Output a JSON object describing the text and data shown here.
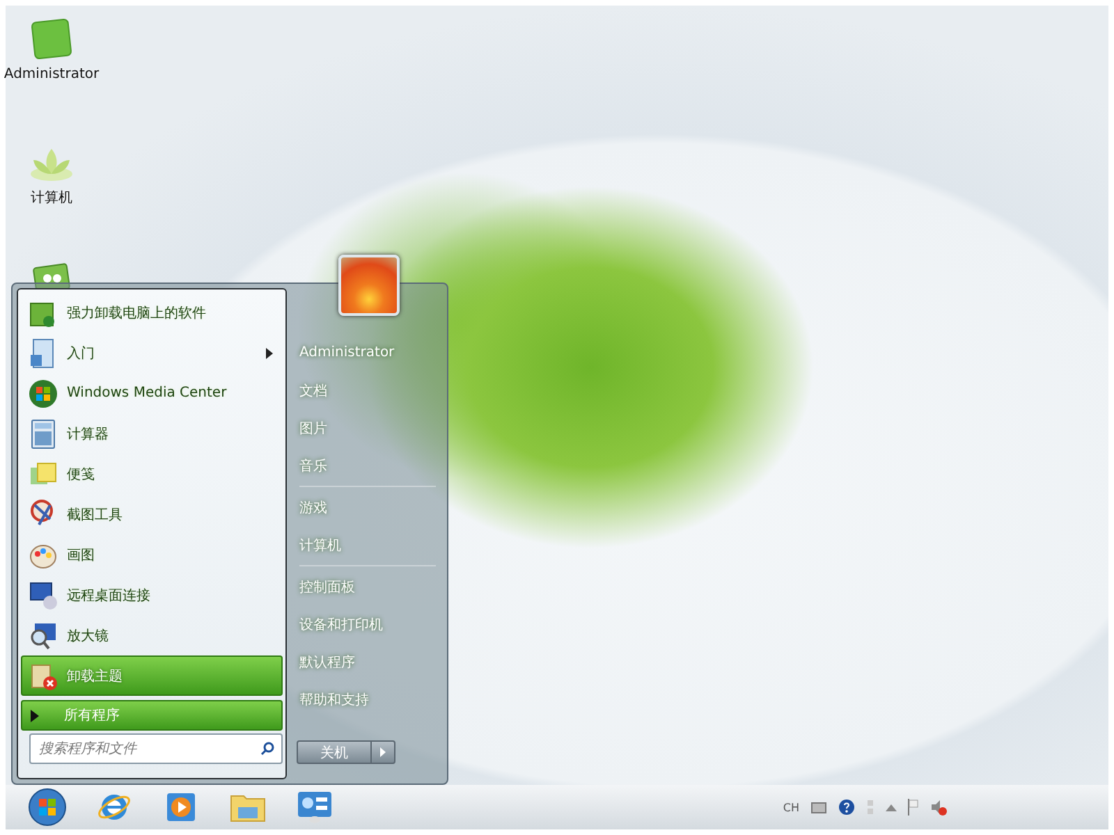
{
  "desktop_icons": [
    {
      "label": "Administrator",
      "kind": "folder"
    },
    {
      "label": "计算机",
      "kind": "computer"
    }
  ],
  "start_menu": {
    "programs": [
      {
        "label": "强力卸载电脑上的软件",
        "kind": "uninstaller",
        "submenu": false,
        "selected": false
      },
      {
        "label": "入门",
        "kind": "getting-started",
        "submenu": true,
        "selected": false
      },
      {
        "label": "Windows Media Center",
        "kind": "media",
        "submenu": false,
        "selected": false
      },
      {
        "label": "计算器",
        "kind": "calculator",
        "submenu": false,
        "selected": false
      },
      {
        "label": "便笺",
        "kind": "notes",
        "submenu": false,
        "selected": false
      },
      {
        "label": "截图工具",
        "kind": "snipping",
        "submenu": false,
        "selected": false
      },
      {
        "label": "画图",
        "kind": "paint",
        "submenu": false,
        "selected": false
      },
      {
        "label": "远程桌面连接",
        "kind": "remote",
        "submenu": false,
        "selected": false
      },
      {
        "label": "放大镜",
        "kind": "magnifier",
        "submenu": false,
        "selected": false
      },
      {
        "label": "卸载主题",
        "kind": "theme-remove",
        "submenu": false,
        "selected": true
      }
    ],
    "all_programs": "所有程序",
    "search": {
      "placeholder": "搜索程序和文件"
    },
    "user": "Administrator",
    "places": [
      [
        "文档",
        "图片",
        "音乐"
      ],
      [
        "游戏",
        "计算机"
      ],
      [
        "控制面板",
        "设备和打印机",
        "默认程序",
        "帮助和支持"
      ]
    ],
    "shutdown": "关机"
  },
  "taskbar": {
    "apps": [
      {
        "kind": "browser"
      },
      {
        "kind": "media-player"
      },
      {
        "kind": "folder"
      },
      {
        "kind": "control"
      }
    ],
    "tray": {
      "language": "CH"
    }
  }
}
